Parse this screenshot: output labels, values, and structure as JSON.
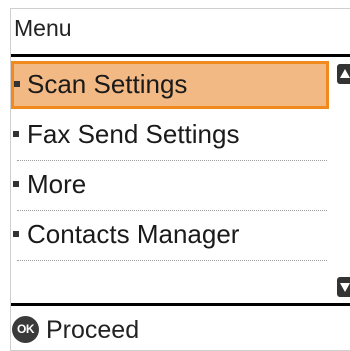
{
  "header": {
    "title": "Menu"
  },
  "menu": {
    "items": [
      {
        "label": "Scan Settings",
        "selected": true
      },
      {
        "label": "Fax Send Settings",
        "selected": false
      },
      {
        "label": "More",
        "selected": false
      },
      {
        "label": "Contacts Manager",
        "selected": false
      }
    ]
  },
  "scrollbar": {
    "up_icon": "arrow-up-icon",
    "down_icon": "arrow-down-icon"
  },
  "footer": {
    "button_icon_text": "OK",
    "label": "Proceed"
  },
  "colors": {
    "selection_fill": "#f2b985",
    "selection_border": "#f08a1e",
    "text": "#1a1a1a"
  }
}
